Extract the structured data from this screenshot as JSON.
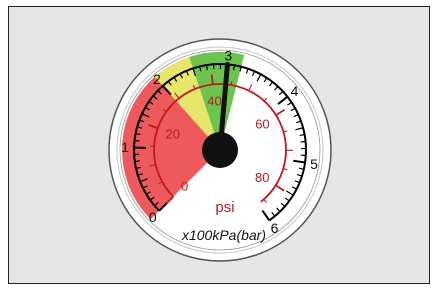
{
  "gauge": {
    "outer_scale_labels": [
      "0",
      "1",
      "2",
      "3",
      "4",
      "5",
      "6"
    ],
    "inner_scale_labels": [
      "0",
      "20",
      "40",
      "60",
      "80"
    ],
    "inner_unit": "psi",
    "outer_unit": "x100kPa(bar)",
    "needle_reading_bar": 3.0,
    "zones": [
      {
        "name": "red",
        "from_bar": 0,
        "to_bar": 2,
        "color": "#ee5a5c"
      },
      {
        "name": "yellow",
        "from_bar": 2,
        "to_bar": 2.5,
        "color": "#e8e66a"
      },
      {
        "name": "green",
        "from_bar": 2.5,
        "to_bar": 3.2,
        "color": "#6cc44e"
      }
    ],
    "colors": {
      "outer_scale": "#000000",
      "inner_scale": "#c0191e",
      "needle": "#111111"
    }
  }
}
